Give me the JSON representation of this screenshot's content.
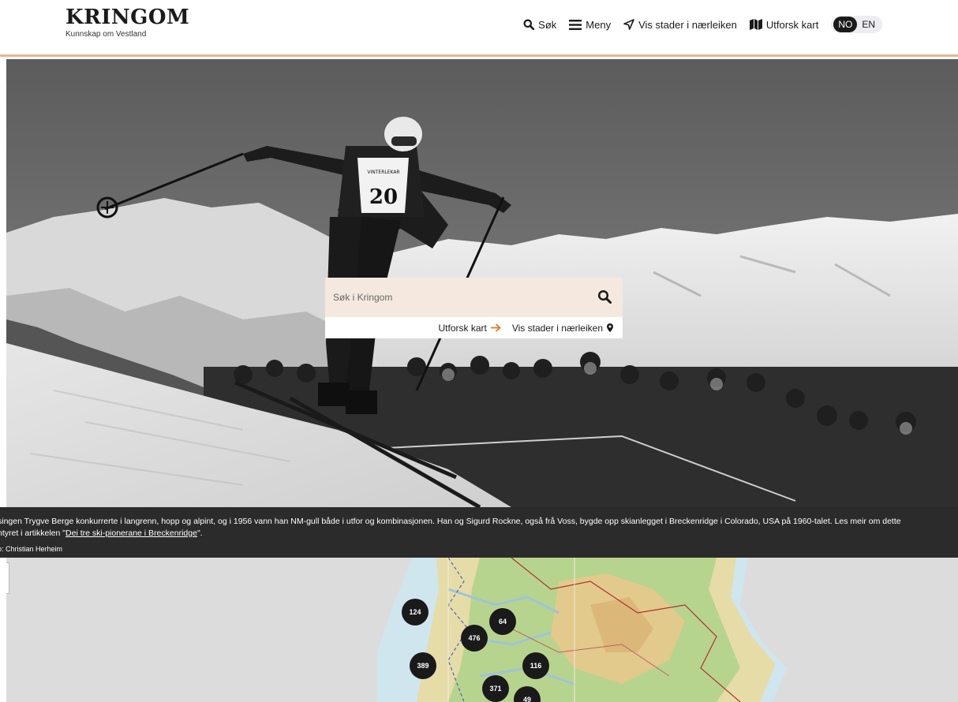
{
  "brand": {
    "title": "KRINGOM",
    "subtitle": "Kunnskap om Vestland"
  },
  "nav": {
    "search": "Søk",
    "menu": "Meny",
    "nearby": "Vis stader i nærleiken",
    "explore_map": "Utforsk kart",
    "lang_no": "NO",
    "lang_en": "EN"
  },
  "hero": {
    "search_placeholder": "Søk i Kringom",
    "link_explore": "Utforsk kart",
    "link_nearby": "Vis stader i nærleiken",
    "bib_number": "20",
    "bib_text": "VINTERLEKAR"
  },
  "caption": {
    "line1": "singen Trygve Berge konkurrerte i langrenn, hopp og alpint, og i 1956 vann han NM-gull både i utfor og kombinasjonen. Han og Sigurd Rockne, også frå Voss, bygde opp skianlegget i Breckenridge i Colorado, USA på 1960-talet. Les meir om dette",
    "line2_prefix": "ntyret i artikkelen \"",
    "line2_link": "Dei tre ski-pionerane i Breckenridge",
    "line2_suffix": "\".",
    "credit": "o: Christian Herheim"
  },
  "map": {
    "clusters": [
      "124",
      "64",
      "476",
      "389",
      "116",
      "371",
      "49"
    ]
  },
  "colors": {
    "accent": "#e8b78f",
    "search_bg": "#f5e8de",
    "caption_bg": "#2b2b2b",
    "cluster": "#1a1a1a",
    "arrow": "#e07b2a"
  }
}
